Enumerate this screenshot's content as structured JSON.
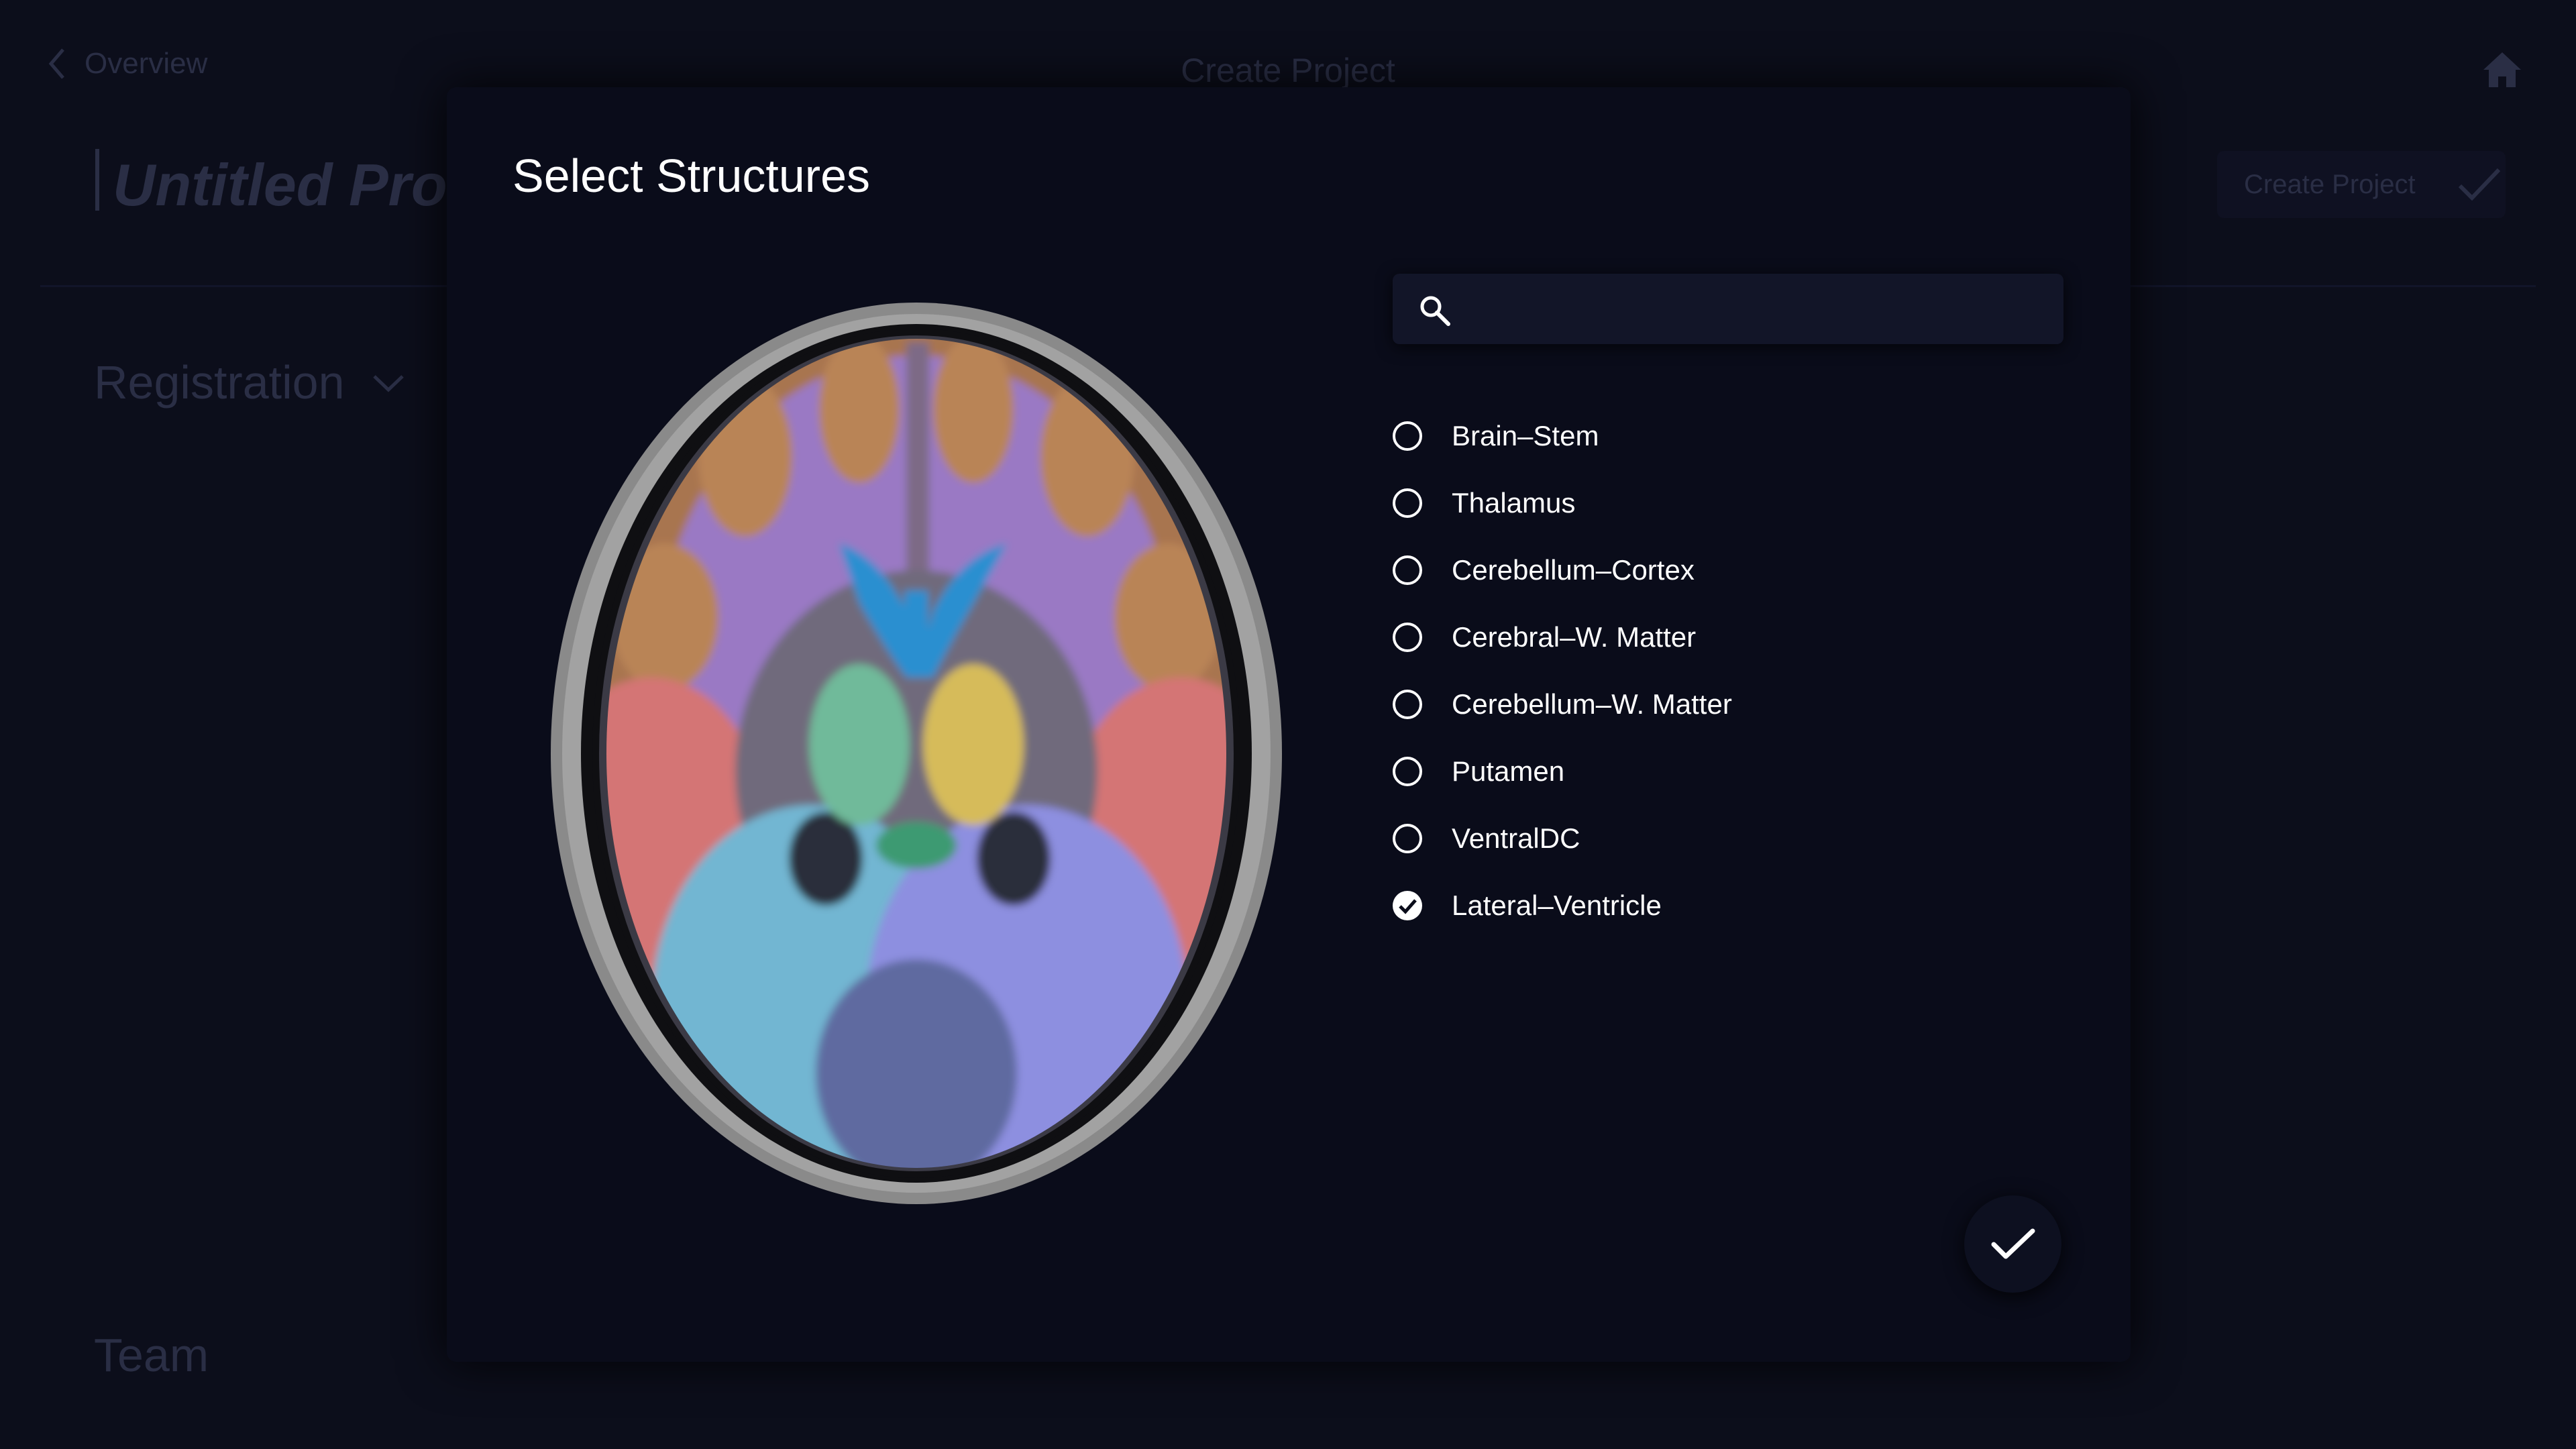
{
  "background": {
    "back_label": "Overview",
    "header_title": "Create Project",
    "project_title": "Untitled Pro",
    "create_button_label": "Create Project",
    "section_registration": "Registration",
    "section_team": "Team"
  },
  "modal": {
    "title": "Select Structures",
    "search": {
      "placeholder": "",
      "value": ""
    },
    "structures": [
      {
        "label": "Brain–Stem",
        "selected": false
      },
      {
        "label": "Thalamus",
        "selected": false
      },
      {
        "label": "Cerebellum–Cortex",
        "selected": false
      },
      {
        "label": "Cerebral–W. Matter",
        "selected": false
      },
      {
        "label": "Cerebellum–W. Matter",
        "selected": false
      },
      {
        "label": "Putamen",
        "selected": false
      },
      {
        "label": "VentralDC",
        "selected": false
      },
      {
        "label": "Lateral–Ventricle",
        "selected": true
      }
    ]
  },
  "colors": {
    "background": "#0c0e1b",
    "modal": "#0a0c1a",
    "dim_text": "#2a2e45",
    "accent_white": "#ffffff"
  }
}
